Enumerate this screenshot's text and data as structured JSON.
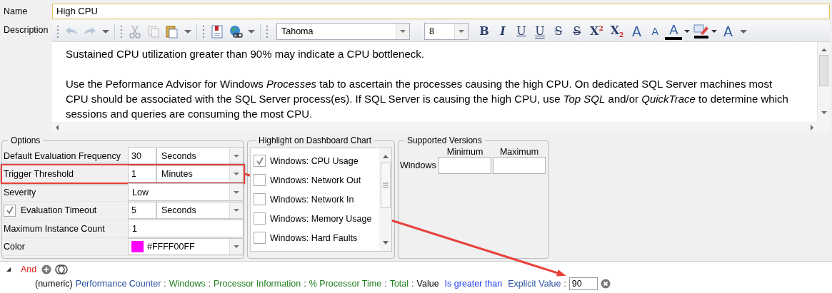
{
  "name_field": {
    "label": "Name",
    "value": "High CPU"
  },
  "description": {
    "label": "Description",
    "font": "Tahoma",
    "size": "8",
    "format_buttons": [
      {
        "kind": "bold",
        "glyph": "B"
      },
      {
        "kind": "italic",
        "glyph": "I"
      },
      {
        "kind": "underline",
        "glyph": "U"
      },
      {
        "kind": "double-underline",
        "glyph": "U"
      },
      {
        "kind": "strike",
        "glyph": "S"
      },
      {
        "kind": "double-strike",
        "glyph": "S"
      },
      {
        "kind": "script",
        "glyph": "X$^{2}$"
      },
      {
        "kind": "script",
        "glyph": "X$_{2}$"
      },
      {
        "kind": "grow",
        "glyph": "A"
      },
      {
        "kind": "shrink",
        "glyph": "A"
      },
      {
        "kind": "color",
        "glyph": "A"
      },
      {
        "kind": "highlight"
      },
      {
        "kind": "style",
        "glyph": "A"
      }
    ],
    "paragraphs": [
      "Sustained CPU utilization greater than 90% may indicate a CPU bottleneck.",
      "Use the Peformance Advisor for Windows *Processes* tab to ascertain the processes causing the high CPU. On dedicated SQL Server machines most CPU should be associated with the SQL Server process(es). If SQL Server is causing the high CPU, use *Top SQL* and/or *QuickTrace* to determine which sessions and queries are consuming the most CPU."
    ]
  },
  "options": {
    "title": "Options",
    "rows": [
      {
        "kind": "combo",
        "label": "Default Evaluation Frequency",
        "value": "30",
        "unit": "Seconds",
        "highlighted": false
      },
      {
        "kind": "combo",
        "label": "Trigger Threshold",
        "value": "1",
        "unit": "Minutes",
        "highlighted": true
      },
      {
        "kind": "dropdown",
        "label": "Severity",
        "value": "Low",
        "highlighted": false
      },
      {
        "kind": "check",
        "label": "Evaluation Timeout",
        "checked": true,
        "value": "5",
        "unit": "Seconds",
        "highlighted": false
      },
      {
        "kind": "text",
        "label": "Maximum Instance Count",
        "value": "1",
        "highlighted": false
      },
      {
        "kind": "color",
        "label": "Color",
        "value": "#FFFF00FF",
        "color": "#ff00ff",
        "highlighted": false
      }
    ]
  },
  "highlight_chart": {
    "title": "Highlight on Dashboard Chart",
    "items": [
      {
        "label": "Windows: CPU Usage",
        "checked": true
      },
      {
        "label": "Windows: Network Out",
        "checked": false
      },
      {
        "label": "Windows: Network In",
        "checked": false
      },
      {
        "label": "Windows: Memory Usage",
        "checked": false
      },
      {
        "label": "Windows: Hard Faults",
        "checked": false
      }
    ]
  },
  "supported_versions": {
    "title": "Supported Versions",
    "columns": [
      "Minimum",
      "Maximum"
    ],
    "rows": [
      {
        "label": "Windows"
      }
    ]
  },
  "condition": {
    "operator": "And",
    "tokens": [
      {
        "kind": "plain",
        "text": "(numeric)"
      },
      {
        "kind": "field",
        "text": "Performance Counter"
      },
      {
        "kind": "sep",
        "text": ":"
      },
      {
        "kind": "path",
        "text": "Windows"
      },
      {
        "kind": "sep",
        "text": ":"
      },
      {
        "kind": "path",
        "text": "Processor Information"
      },
      {
        "kind": "sep",
        "text": ":"
      },
      {
        "kind": "path",
        "text": "% Processor Time"
      },
      {
        "kind": "sep",
        "text": ":"
      },
      {
        "kind": "path",
        "text": "Total"
      },
      {
        "kind": "sep",
        "text": ":"
      },
      {
        "kind": "plain",
        "text": "Value"
      },
      {
        "kind": "op",
        "text": "Is greater than"
      },
      {
        "kind": "field",
        "text": "Explicit Value"
      },
      {
        "kind": "sep",
        "text": ":"
      }
    ],
    "value": "90"
  }
}
